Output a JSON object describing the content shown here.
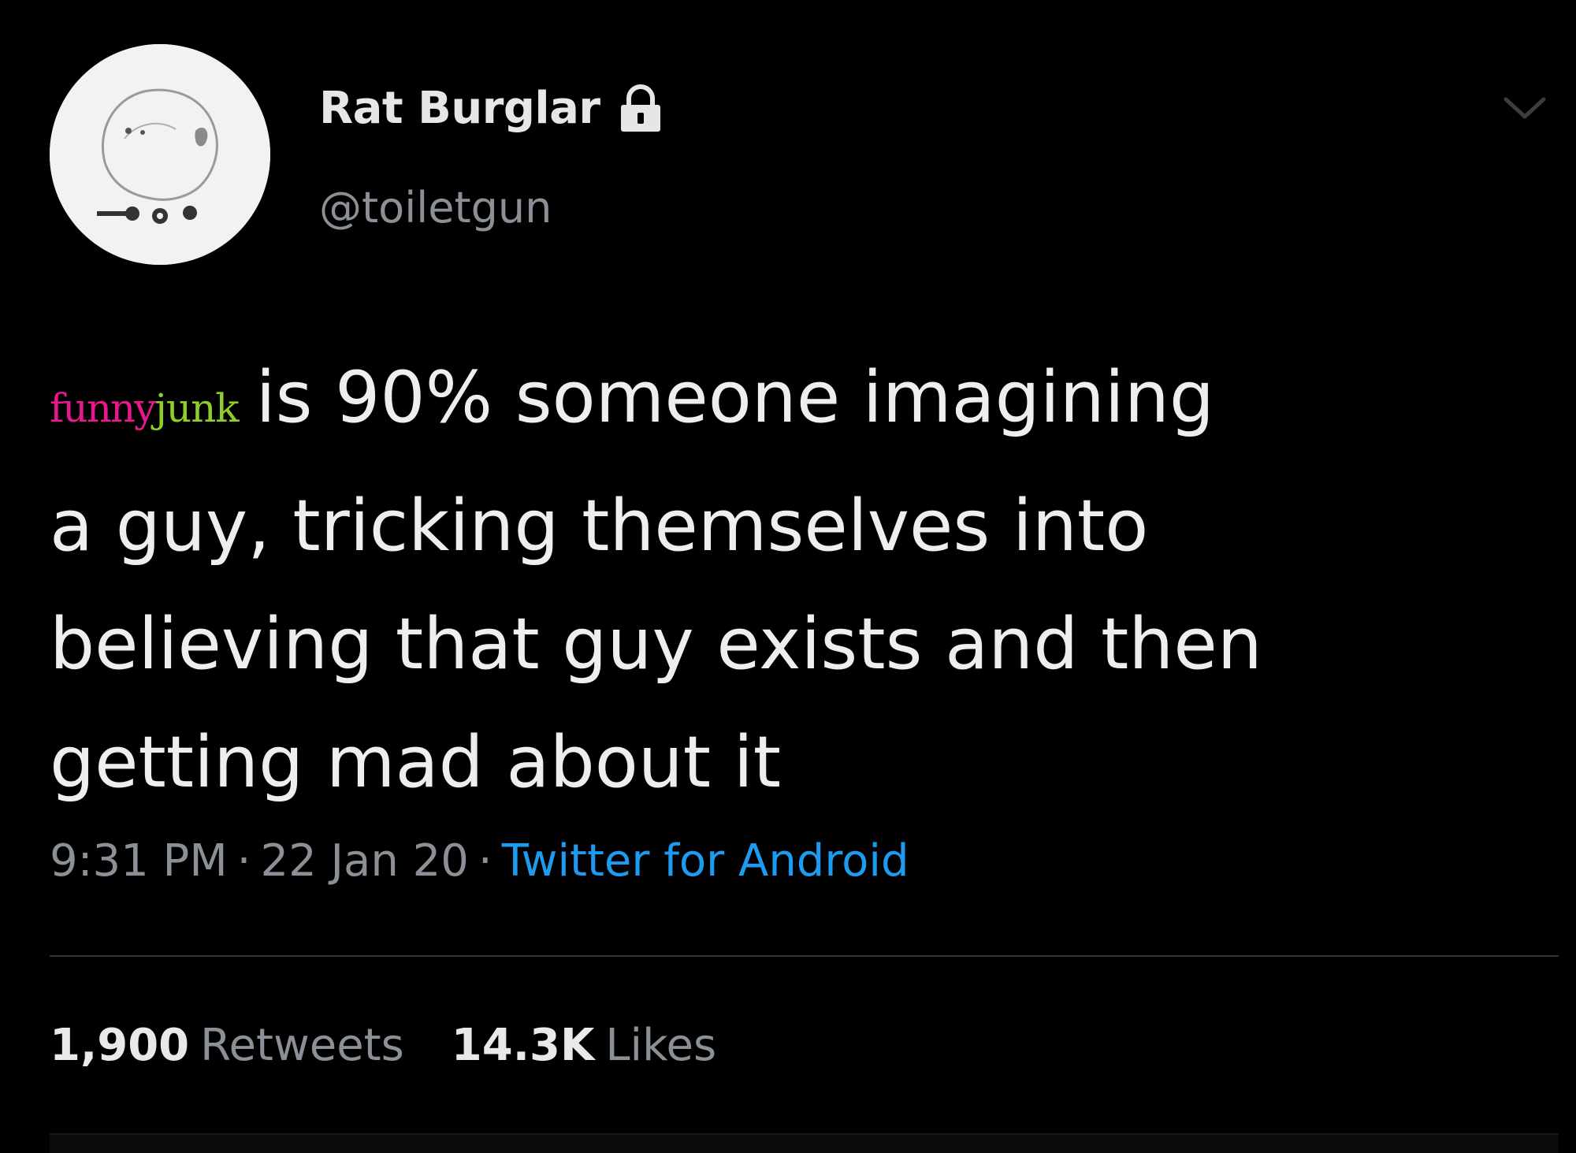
{
  "tweet": {
    "display_name": "Rat Burglar",
    "handle": "@toiletgun",
    "body_prefix_logo": {
      "funny": "funny",
      "junk": "junk"
    },
    "body_lines": [
      "is 90% someone imagining",
      "a guy, tricking themselves into",
      "believing that guy exists and then",
      "getting mad about it"
    ],
    "time": "9:31 PM",
    "separator": "·",
    "date": "22 Jan 20",
    "source": "Twitter for Android",
    "retweets_count": "1,900",
    "retweets_label": "Retweets",
    "likes_count": "14.3K",
    "likes_label": "Likes"
  },
  "icons": {
    "avatar": "avatar-sketch",
    "lock": "lock-icon",
    "menu": "chevron-down-icon"
  },
  "colors": {
    "background": "#000000",
    "text_primary": "#e7e9ea",
    "text_secondary": "#8b9096",
    "link": "#1d9bf0",
    "logo_funny": "#e8178e",
    "logo_junk": "#8fce2a"
  }
}
